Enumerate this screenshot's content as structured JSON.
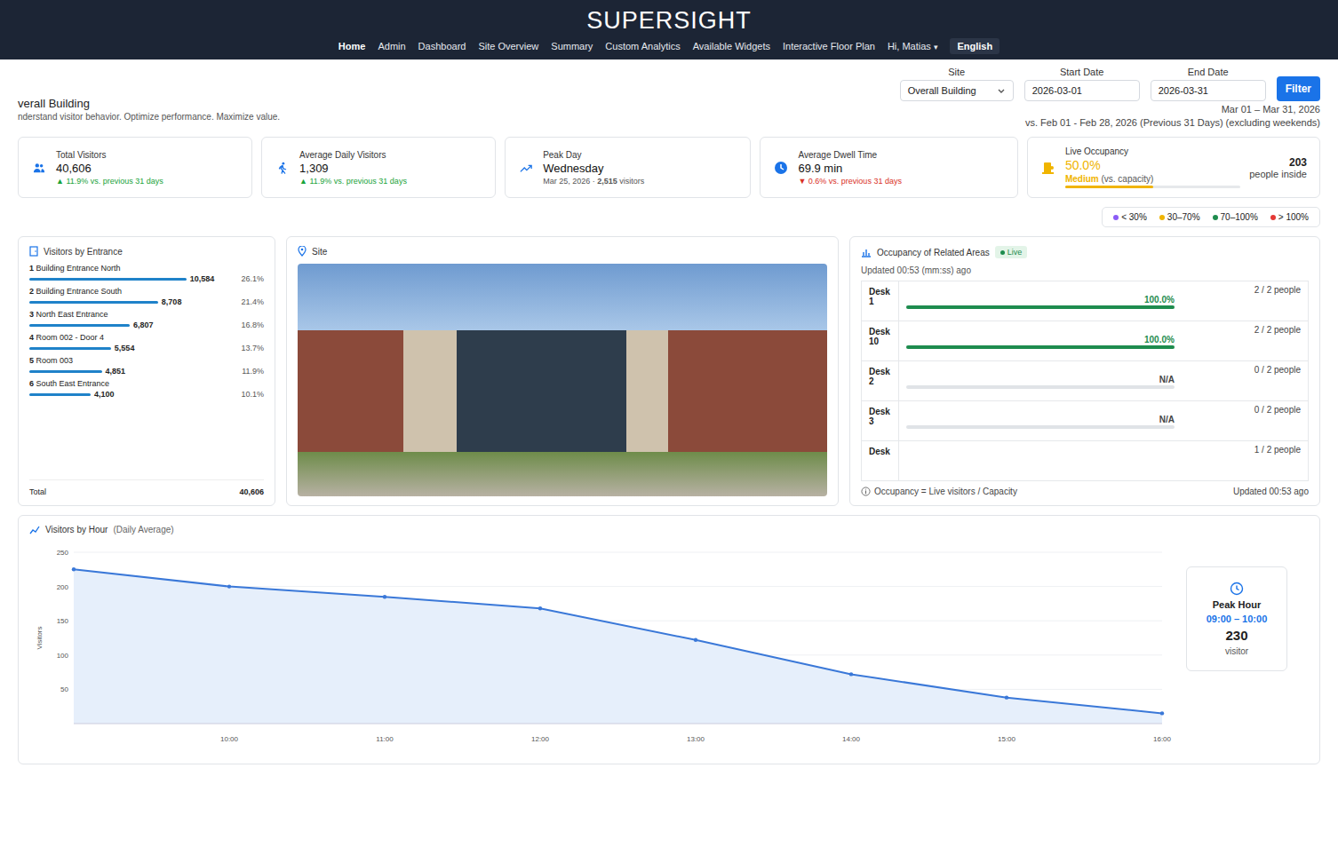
{
  "nav": {
    "logo": "SUPERSIGHT",
    "links": [
      {
        "label": "Home",
        "selected": true
      },
      {
        "label": "Admin",
        "selected": false
      },
      {
        "label": "Dashboard",
        "selected": false
      },
      {
        "label": "Site Overview",
        "selected": false
      },
      {
        "label": "Summary",
        "selected": false
      },
      {
        "label": "Custom Analytics",
        "selected": false
      },
      {
        "label": "Available Widgets",
        "selected": false
      },
      {
        "label": "Interactive Floor Plan",
        "selected": false
      }
    ],
    "user": "Hi, Matias",
    "user_caret": "▾",
    "language": "English"
  },
  "page": {
    "title": "verall Building",
    "subtitle": "nderstand visitor behavior. Optimize performance. Maximize value."
  },
  "filters": {
    "site_label": "Site",
    "site_value": "Overall Building",
    "start_label": "Start Date",
    "start_value": "2026-03-01",
    "end_label": "End Date",
    "end_value": "2026-03-31",
    "button": "Filter",
    "range": "Mar 01 – Mar 31, 2026",
    "comparison": "vs. Feb 01 - Feb 28, 2026 (Previous 31 Days) (excluding weekends)"
  },
  "kpis": [
    {
      "kind": "change",
      "label": "Total Visitors",
      "value": "40,606",
      "arrow": "▲",
      "change": "11.9% vs. previous 31 days",
      "trend": "up"
    },
    {
      "kind": "change",
      "label": "Average Daily Visitors",
      "value": "1,309",
      "arrow": "▲",
      "change": "11.9% vs. previous 31 days",
      "trend": "up"
    },
    {
      "kind": "detail",
      "label": "Peak Day",
      "value": "Wednesday",
      "detail": "Mar 25, 2026 · ",
      "detail_bold": "2,515",
      "detail_suffix": " visitors"
    },
    {
      "kind": "change",
      "label": "Average Dwell Time",
      "value": "69.9 min",
      "arrow": "▼",
      "change": "0.6% vs. previous 31 days",
      "trend": "down"
    }
  ],
  "live": {
    "label": "Live Occupancy",
    "percent": "50.0%",
    "status": "Medium",
    "status_note": "(vs. capacity)",
    "level": 0.5,
    "color": "#f0b400",
    "count": "203",
    "count_label": "people inside"
  },
  "legend": [
    {
      "label": "< 30%",
      "color": "#8b5cf6"
    },
    {
      "label": "30–70%",
      "color": "#f0b400"
    },
    {
      "label": "70–100%",
      "color": "#1e8c4e"
    },
    {
      "label": "> 100%",
      "color": "#e53935"
    }
  ],
  "entrances": {
    "title": "Visitors by Entrance",
    "rows": [
      {
        "rank": "1",
        "name": "Building Entrance North",
        "count": "10,584",
        "share": "26.1%",
        "level": 1.0
      },
      {
        "rank": "2",
        "name": "Building Entrance South",
        "count": "8,708",
        "share": "21.4%",
        "level": 0.82
      },
      {
        "rank": "3",
        "name": "North East Entrance",
        "count": "6,807",
        "share": "16.8%",
        "level": 0.64
      },
      {
        "rank": "4",
        "name": "Room 002 - Door 4",
        "count": "5,554",
        "share": "13.7%",
        "level": 0.52
      },
      {
        "rank": "5",
        "name": "Room 003",
        "count": "4,851",
        "share": "11.9%",
        "level": 0.46
      },
      {
        "rank": "6",
        "name": "South East Entrance",
        "count": "4,100",
        "share": "10.1%",
        "level": 0.39
      }
    ],
    "total_label": "Total",
    "total": "40,606"
  },
  "site": {
    "title": "Site"
  },
  "occupancy": {
    "title": "Occupancy of Related Areas",
    "badge": "Live",
    "updated": "Updated 00:53 (mm:ss) ago",
    "rows": [
      {
        "kind": "bar",
        "name": "Desk 1",
        "value": "100.0%",
        "level": 1.0,
        "color": "#1e8c4e",
        "people": "2 / 2 people"
      },
      {
        "kind": "bar",
        "name": "Desk 10",
        "value": "100.0%",
        "level": 1.0,
        "color": "#1e8c4e",
        "people": "2 / 2 people"
      },
      {
        "kind": "bar",
        "name": "Desk 2",
        "value": "N/A",
        "level": 0,
        "color": "#9aa0a6",
        "people": "0 / 2 people"
      },
      {
        "kind": "bar",
        "name": "Desk 3",
        "value": "N/A",
        "level": 0,
        "color": "#9aa0a6",
        "people": "0 / 2 people"
      },
      {
        "kind": "partial",
        "name": "Desk",
        "people": "1 / 2 people"
      }
    ],
    "footnote": "Occupancy = Live visitors / Capacity",
    "footer_updated": "Updated 00:53 ago"
  },
  "chart": {
    "title": "Visitors by Hour",
    "subtitle": "(Daily Average)",
    "y_label": "Visitors",
    "y_ticks": [
      "250",
      "200",
      "150",
      "100",
      "50"
    ],
    "x_ticks": [
      "10:00",
      "11:00",
      "12:00",
      "13:00",
      "14:00",
      "15:00",
      "16:00"
    ],
    "values": [
      225,
      200,
      185,
      168,
      122,
      72,
      38,
      15
    ],
    "peak": {
      "label": "Peak Hour",
      "range": "09:00 – 10:00",
      "value": "230",
      "unit": "visitor"
    }
  }
}
